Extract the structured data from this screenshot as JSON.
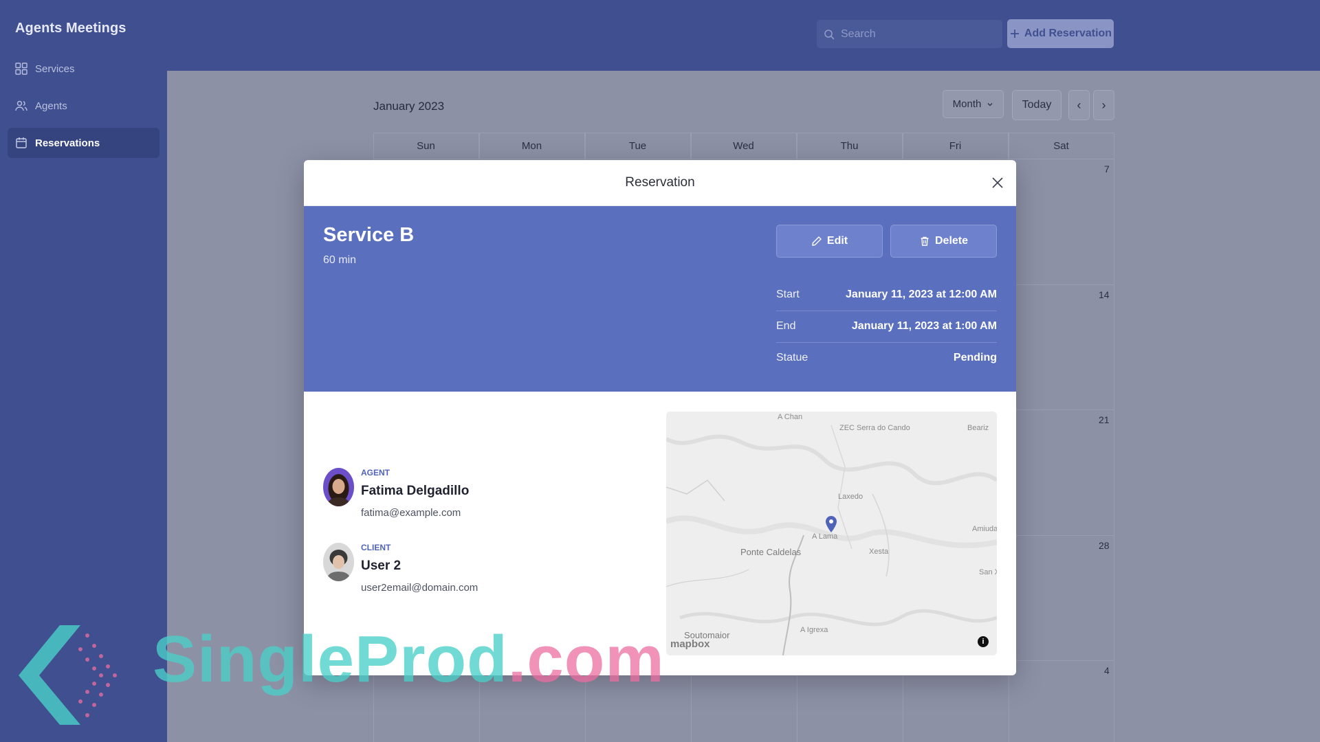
{
  "app": {
    "title": "Agents Meetings"
  },
  "sidebar": {
    "items": [
      {
        "label": "Services",
        "icon": "grid-icon"
      },
      {
        "label": "Agents",
        "icon": "users-icon"
      },
      {
        "label": "Reservations",
        "icon": "calendar-icon",
        "active": true
      }
    ]
  },
  "header": {
    "search_placeholder": "Search",
    "add_button": "Add Reservation"
  },
  "calendar": {
    "title": "January 2023",
    "view": "Month",
    "today_label": "Today",
    "prev_label": "‹",
    "next_label": "›",
    "weekdays": [
      "Sun",
      "Mon",
      "Tue",
      "Wed",
      "Thu",
      "Fri",
      "Sat"
    ],
    "visible_day_numbers": [
      "7",
      "14",
      "21",
      "28",
      "4"
    ]
  },
  "modal": {
    "title": "Reservation",
    "service_name": "Service B",
    "duration": "60 min",
    "edit_label": "Edit",
    "delete_label": "Delete",
    "details": [
      {
        "label": "Start",
        "value": "January 11, 2023 at 12:00 AM"
      },
      {
        "label": "End",
        "value": "January 11, 2023 at 1:00 AM"
      },
      {
        "label": "Statue",
        "value": "Pending"
      }
    ],
    "agent": {
      "role": "AGENT",
      "name": "Fatima Delgadillo",
      "email": "fatima@example.com"
    },
    "client": {
      "role": "CLIENT",
      "name": "User 2",
      "email": "user2email@domain.com"
    },
    "map": {
      "labels": [
        "A Chan",
        "ZEC Serra do Cando",
        "Beariz",
        "Laxedo",
        "Amiudal",
        "A Lama",
        "Ponte Caldelas",
        "Xesta",
        "San X",
        "Soutomaior",
        "A Igrexa"
      ],
      "attribution": "mapbox",
      "info_label": "i"
    }
  },
  "watermark": {
    "part1": "SingleProd",
    "part2": ".com"
  },
  "colors": {
    "sidebar": "#3f4f90",
    "accent": "#5a6fbd",
    "overlay": "#8d91a6"
  }
}
